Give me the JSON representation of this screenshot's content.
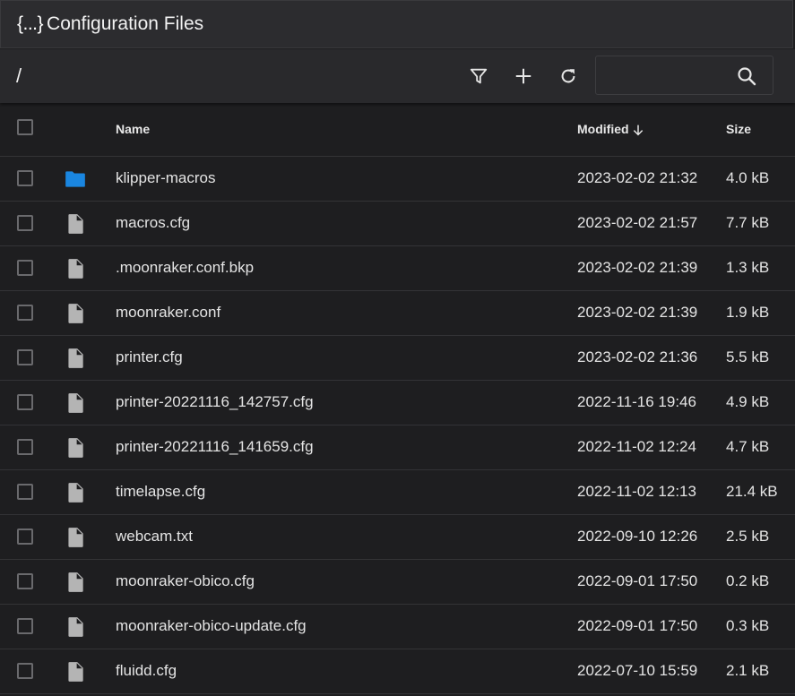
{
  "header": {
    "icon_text": "{...}",
    "title": "Configuration Files"
  },
  "toolbar": {
    "path": "/",
    "search_placeholder": "",
    "buttons": [
      "filter-icon",
      "plus-icon",
      "refresh-icon"
    ]
  },
  "table": {
    "columns": {
      "name": "Name",
      "modified": "Modified",
      "size": "Size"
    },
    "sort": {
      "column": "modified",
      "direction": "descending"
    },
    "rows": [
      {
        "type": "folder",
        "name": "klipper-macros",
        "modified": "2023-02-02 21:32",
        "size": "4.0 kB"
      },
      {
        "type": "file",
        "name": "macros.cfg",
        "modified": "2023-02-02 21:57",
        "size": "7.7 kB"
      },
      {
        "type": "file",
        "name": ".moonraker.conf.bkp",
        "modified": "2023-02-02 21:39",
        "size": "1.3 kB"
      },
      {
        "type": "file",
        "name": "moonraker.conf",
        "modified": "2023-02-02 21:39",
        "size": "1.9 kB"
      },
      {
        "type": "file",
        "name": "printer.cfg",
        "modified": "2023-02-02 21:36",
        "size": "5.5 kB"
      },
      {
        "type": "file",
        "name": "printer-20221116_142757.cfg",
        "modified": "2022-11-16 19:46",
        "size": "4.9 kB"
      },
      {
        "type": "file",
        "name": "printer-20221116_141659.cfg",
        "modified": "2022-11-02 12:24",
        "size": "4.7 kB"
      },
      {
        "type": "file",
        "name": "timelapse.cfg",
        "modified": "2022-11-02 12:13",
        "size": "21.4 kB"
      },
      {
        "type": "file",
        "name": "webcam.txt",
        "modified": "2022-09-10 12:26",
        "size": "2.5 kB"
      },
      {
        "type": "file",
        "name": "moonraker-obico.cfg",
        "modified": "2022-09-01 17:50",
        "size": "0.2 kB"
      },
      {
        "type": "file",
        "name": "moonraker-obico-update.cfg",
        "modified": "2022-09-01 17:50",
        "size": "0.3 kB"
      },
      {
        "type": "file",
        "name": "fluidd.cfg",
        "modified": "2022-07-10 15:59",
        "size": "2.1 kB"
      }
    ]
  },
  "colors": {
    "folder": "#1a86e0",
    "file_icon": "#b4b4b4",
    "background": "#1e1e20",
    "header_bar": "#2c2c2f"
  }
}
